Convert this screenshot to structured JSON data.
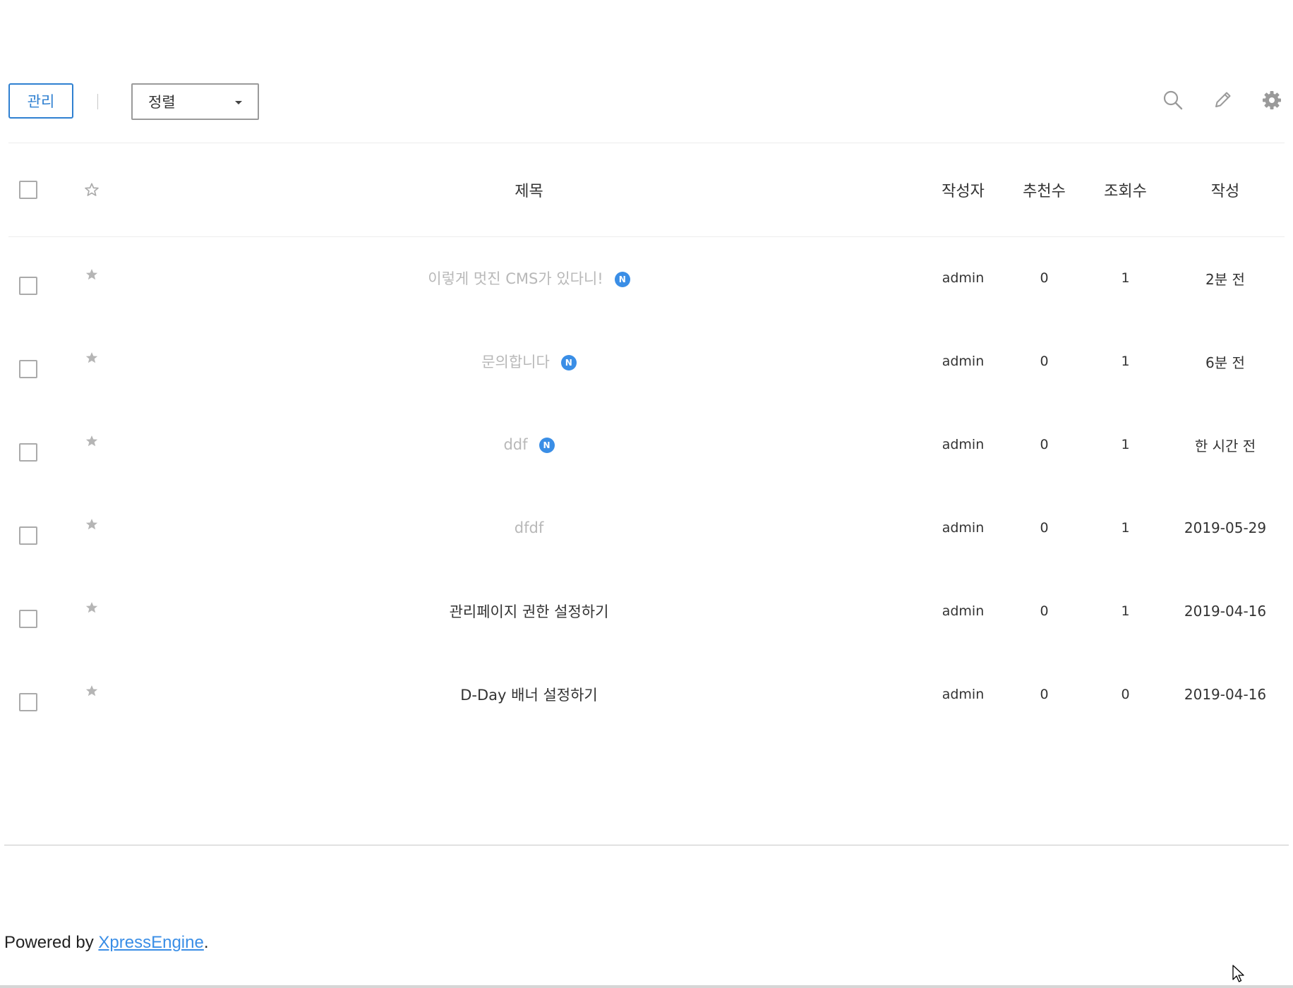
{
  "toolbar": {
    "manage_label": "관리",
    "sort": {
      "selected": "정렬"
    },
    "icons": [
      "search-icon",
      "pencil-icon",
      "gear-icon"
    ]
  },
  "table": {
    "headers": {
      "title": "제목",
      "writer": "작성자",
      "votes": "추천수",
      "views": "조회수",
      "date": "작성"
    },
    "rows": [
      {
        "title": "이렇게 멋진 CMS가 있다니!",
        "is_new": true,
        "new_label": "N",
        "read": true,
        "writer": "admin",
        "votes": "0",
        "views": "1",
        "date": "2분 전"
      },
      {
        "title": "문의합니다",
        "is_new": true,
        "new_label": "N",
        "read": true,
        "writer": "admin",
        "votes": "0",
        "views": "1",
        "date": "6분 전"
      },
      {
        "title": "ddf",
        "is_new": true,
        "new_label": "N",
        "read": true,
        "writer": "admin",
        "votes": "0",
        "views": "1",
        "date": "한 시간 전"
      },
      {
        "title": "dfdf",
        "is_new": false,
        "read": true,
        "writer": "admin",
        "votes": "0",
        "views": "1",
        "date": "2019-05-29"
      },
      {
        "title": "관리페이지 권한 설정하기",
        "is_new": false,
        "read": false,
        "writer": "admin",
        "votes": "0",
        "views": "1",
        "date": "2019-04-16"
      },
      {
        "title": "D-Day 배너 설정하기",
        "is_new": false,
        "read": false,
        "writer": "admin",
        "votes": "0",
        "views": "0",
        "date": "2019-04-16"
      }
    ]
  },
  "footer": {
    "prefix": "Powered by ",
    "link_text": "XpressEngine",
    "suffix": "."
  },
  "colors": {
    "accent": "#2f80d1",
    "new_badge": "#3a8ee6",
    "read_title": "#b8b8b8"
  }
}
